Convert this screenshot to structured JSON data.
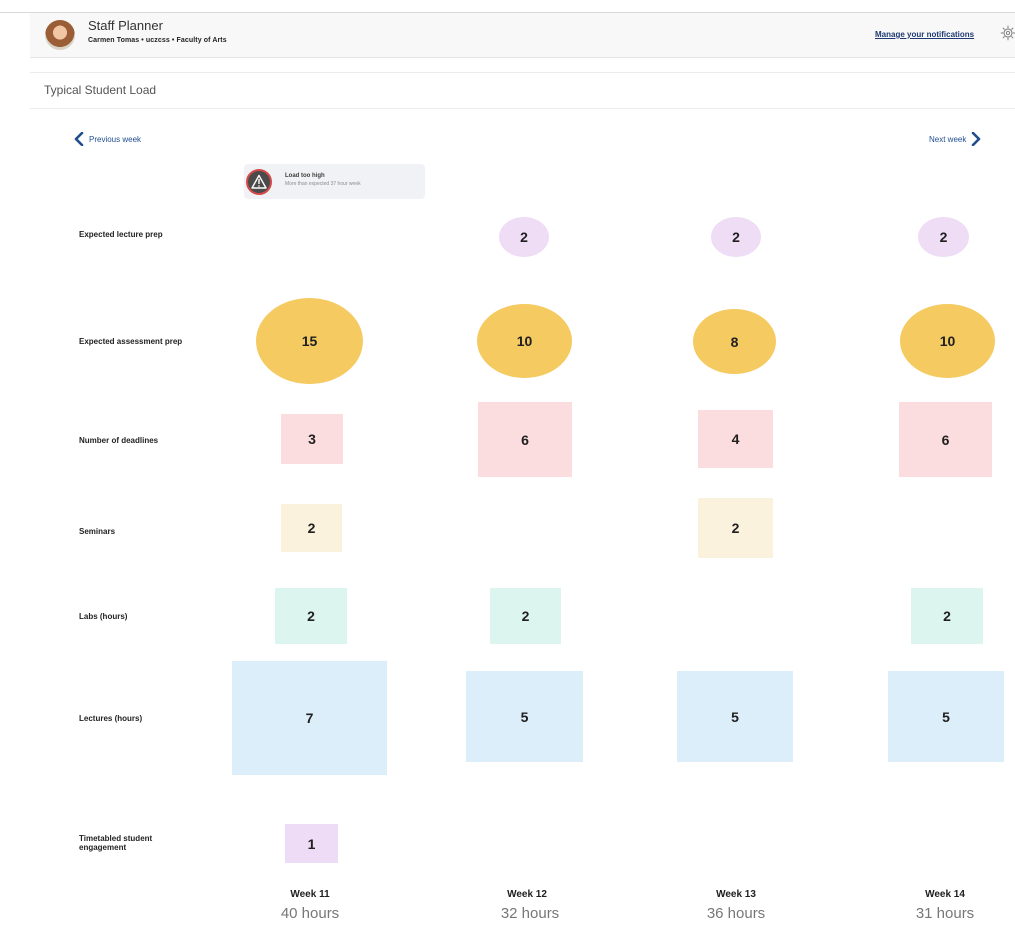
{
  "header": {
    "app_title": "Staff Planner",
    "subtitle": "Carmen Tomas • uczcss • Faculty of Arts",
    "manage_link": "Manage your notifications",
    "settings_icon": "settings-gear-icon"
  },
  "panel": {
    "title": "Typical Student Load"
  },
  "nav": {
    "previous": "Previous week",
    "next": "Next week"
  },
  "warning": {
    "title": "Load too high",
    "text": "More than expected 37 hour week",
    "icon": "warning-triangle-icon"
  },
  "row_labels": {
    "lecture_prep": "Expected lecture prep",
    "assessment_prep": "Expected assessment prep",
    "deadlines": "Number of deadlines",
    "seminars": "Seminars",
    "labs": "Labs (hours)",
    "lectures": "Lectures (hours)",
    "engagement_line1": "Timetabled student",
    "engagement_line2": "engagement"
  },
  "metrics": {
    "week11": {
      "assessment_prep": "15",
      "deadlines": "3",
      "seminars": "2",
      "labs": "2",
      "lectures": "7",
      "engagement": "1"
    },
    "week12": {
      "lecture_prep": "2",
      "assessment_prep": "10",
      "deadlines": "6",
      "labs": "2",
      "lectures": "5"
    },
    "week13": {
      "lecture_prep": "2",
      "assessment_prep": "8",
      "deadlines": "4",
      "seminars": "2",
      "lectures": "5"
    },
    "week14": {
      "lecture_prep": "2",
      "assessment_prep": "10",
      "deadlines": "6",
      "labs": "2",
      "lectures": "5"
    }
  },
  "weeks": [
    {
      "name": "Week 11",
      "hours": "40 hours"
    },
    {
      "name": "Week 12",
      "hours": "32 hours"
    },
    {
      "name": "Week 13",
      "hours": "36 hours"
    },
    {
      "name": "Week 14",
      "hours": "31 hours"
    }
  ],
  "colors": {
    "lecture_prep": "#efdcf5",
    "assessment_prep": "#f5ca61",
    "deadlines": "#fbdcdf",
    "seminars": "#fbf2dd",
    "labs": "#dcf5ee",
    "lectures": "#ddeefb",
    "engagement": "#eedcf7",
    "link": "#1f3a73"
  }
}
